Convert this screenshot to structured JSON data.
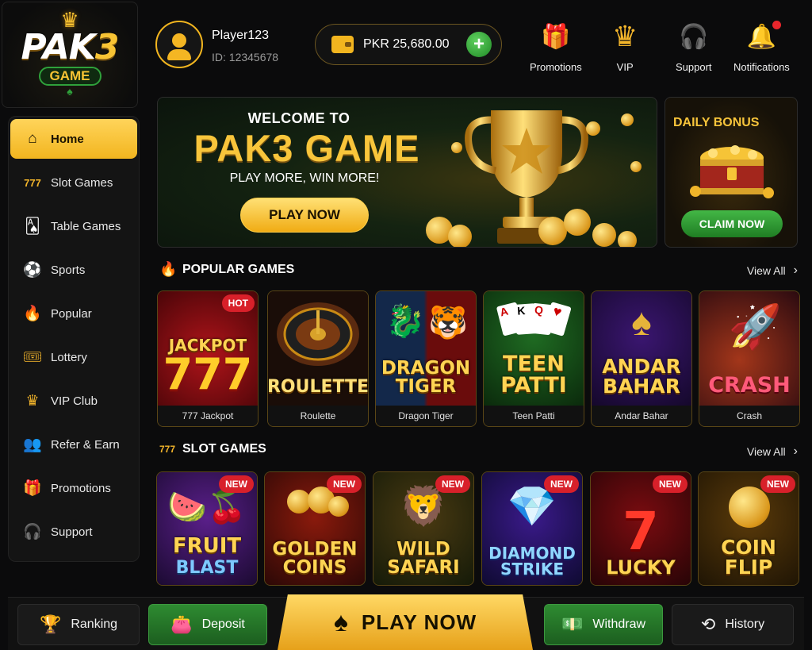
{
  "logo": {
    "brand_left": "PAK",
    "brand_right": "3",
    "sub": "GAME"
  },
  "sidebar": {
    "items": [
      {
        "label": "Home",
        "icon": "home-icon"
      },
      {
        "label": "Slot Games",
        "icon": "slot-icon"
      },
      {
        "label": "Table Games",
        "icon": "cards-icon"
      },
      {
        "label": "Sports",
        "icon": "soccer-ball-icon"
      },
      {
        "label": "Popular",
        "icon": "fire-icon"
      },
      {
        "label": "Lottery",
        "icon": "ticket-icon"
      },
      {
        "label": "VIP Club",
        "icon": "crown-icon"
      },
      {
        "label": "Refer & Earn",
        "icon": "users-icon"
      },
      {
        "label": "Promotions",
        "icon": "gift-icon"
      },
      {
        "label": "Support",
        "icon": "headset-icon"
      }
    ],
    "active": "Home"
  },
  "user": {
    "name": "Player123",
    "id": "ID: 12345678"
  },
  "balance": {
    "amount": "PKR 25,680.00"
  },
  "topnav": {
    "promotions": "Promotions",
    "vip": "VIP",
    "support": "Support",
    "notifications": "Notifications"
  },
  "banner": {
    "welcome": "WELCOME TO",
    "title": "PAK3 GAME",
    "tagline": "PLAY MORE, WIN MORE!",
    "button": "PLAY NOW"
  },
  "bonus": {
    "title": "DAILY BONUS",
    "button": "CLAIM NOW"
  },
  "popular": {
    "title": "POPULAR GAMES",
    "view_all": "View All",
    "games": [
      {
        "art": "JACKPOT 777",
        "name": "777 Jackpot",
        "badge": "HOT"
      },
      {
        "art": "ROULETTE",
        "name": "Roulette",
        "badge": ""
      },
      {
        "art": "DRAGON TIGER",
        "name": "Dragon Tiger",
        "badge": ""
      },
      {
        "art": "TEEN PATTI",
        "name": "Teen Patti",
        "badge": ""
      },
      {
        "art": "ANDAR BAHAR",
        "name": "Andar Bahar",
        "badge": ""
      },
      {
        "art": "CRASH",
        "name": "Crash",
        "badge": ""
      }
    ]
  },
  "slots": {
    "title": "SLOT GAMES",
    "view_all": "View All",
    "games": [
      {
        "art1": "FRUIT",
        "art2": "BLAST",
        "badge": "NEW"
      },
      {
        "art1": "GOLDEN",
        "art2": "COINS",
        "badge": "NEW"
      },
      {
        "art1": "WILD",
        "art2": "SAFARI",
        "badge": "NEW"
      },
      {
        "art1": "DIAMOND",
        "art2": "STRIKE",
        "badge": "NEW"
      },
      {
        "art1": "7",
        "art2": "LUCKY",
        "badge": "NEW"
      },
      {
        "art1": "COIN",
        "art2": "FLIP",
        "badge": "NEW"
      }
    ]
  },
  "bottombar": {
    "ranking": "Ranking",
    "deposit": "Deposit",
    "play": "PLAY NOW",
    "withdraw": "Withdraw",
    "history": "History"
  },
  "colors": {
    "accent_gold": "#f2b51f",
    "green": "#2e8b31",
    "badge_red": "#d8202a",
    "background": "#0b0b0c"
  }
}
